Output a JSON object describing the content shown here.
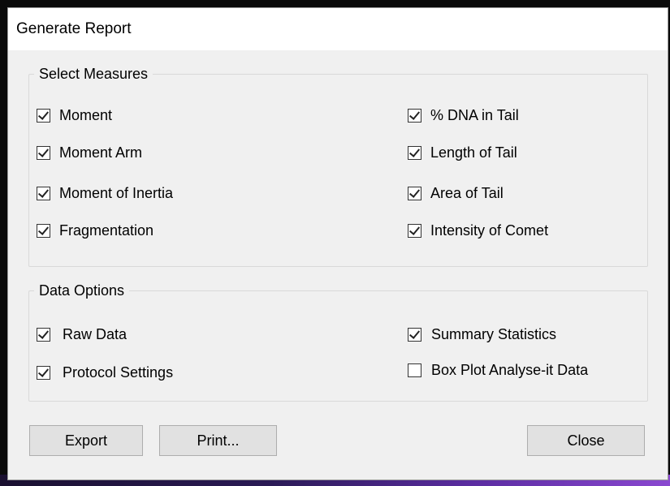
{
  "window": {
    "title": "Generate Report"
  },
  "measures": {
    "legend": "Select Measures",
    "items": [
      {
        "label": "Moment",
        "checked": true
      },
      {
        "label": "Moment Arm",
        "checked": true
      },
      {
        "label": "Moment of Inertia",
        "checked": true
      },
      {
        "label": "Fragmentation",
        "checked": true
      },
      {
        "label": "% DNA in Tail",
        "checked": true
      },
      {
        "label": "Length of Tail",
        "checked": true
      },
      {
        "label": "Area of Tail",
        "checked": true
      },
      {
        "label": "Intensity of Comet",
        "checked": true
      }
    ]
  },
  "data_options": {
    "legend": "Data Options",
    "items": [
      {
        "label": "Raw Data",
        "checked": true
      },
      {
        "label": "Protocol Settings",
        "checked": true
      },
      {
        "label": "Summary Statistics",
        "checked": true
      },
      {
        "label": "Box Plot Analyse-it Data",
        "checked": false
      }
    ]
  },
  "buttons": {
    "export": "Export",
    "print": "Print...",
    "close": "Close"
  }
}
